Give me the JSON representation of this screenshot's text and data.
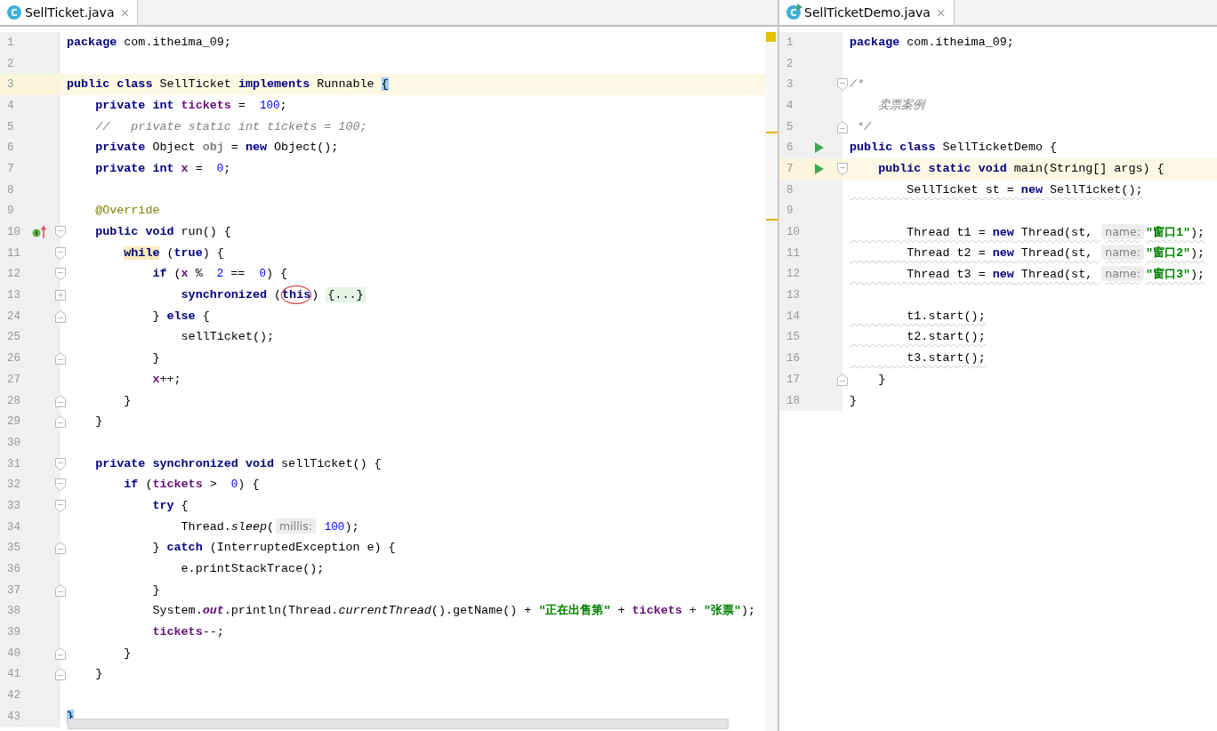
{
  "editors": [
    {
      "tab": {
        "icon_letter": "C",
        "kind": "class",
        "label": "SellTicket.java",
        "close": "×",
        "selected": true
      },
      "stripe_marks": [
        {
          "kind": "status"
        },
        {
          "kind": "warning"
        },
        {
          "kind": "warning"
        }
      ],
      "horizontal_scrollbar": true,
      "lines": [
        {
          "n": "1",
          "code": [
            {
              "kind": "kw",
              "text": "package"
            },
            {
              "kind": "plain",
              "text": " com.itheima_09;"
            }
          ]
        },
        {
          "n": "2"
        },
        {
          "n": "3",
          "current": true,
          "code": [
            {
              "kind": "kw",
              "text": "public class"
            },
            {
              "kind": "plain",
              "text": " SellTicket "
            },
            {
              "kind": "kw",
              "text": "implements"
            },
            {
              "kind": "plain",
              "text": " Runnable "
            },
            {
              "kind": "brace",
              "text": "{"
            }
          ]
        },
        {
          "n": "4",
          "code": [
            {
              "kind": "kw",
              "text": "    private int "
            },
            {
              "kind": "field",
              "text": "tickets"
            },
            {
              "kind": "plain",
              "text": " = "
            },
            {
              "kind": "num",
              "text": "100"
            },
            {
              "kind": "plain",
              "text": ";"
            }
          ]
        },
        {
          "n": "5",
          "code": [
            {
              "kind": "comment",
              "text": "    //   private static int tickets = 100;"
            }
          ]
        },
        {
          "n": "6",
          "code": [
            {
              "kind": "kw",
              "text": "    private"
            },
            {
              "kind": "plain",
              "text": " Object "
            },
            {
              "kind": "unused",
              "text": "obj"
            },
            {
              "kind": "plain",
              "text": " = "
            },
            {
              "kind": "kw",
              "text": "new"
            },
            {
              "kind": "plain",
              "text": " Object();"
            }
          ]
        },
        {
          "n": "7",
          "code": [
            {
              "kind": "kw",
              "text": "    private int "
            },
            {
              "kind": "field",
              "text": "x"
            },
            {
              "kind": "plain",
              "text": " = "
            },
            {
              "kind": "num",
              "text": "0"
            },
            {
              "kind": "plain",
              "text": ";"
            }
          ]
        },
        {
          "n": "8"
        },
        {
          "n": "9",
          "code": [
            {
              "kind": "annot",
              "text": "    @Override"
            }
          ]
        },
        {
          "n": "10",
          "kind": "implements",
          "fold_start": true,
          "code": [
            {
              "kind": "kw",
              "text": "    public void"
            },
            {
              "kind": "plain",
              "text": " run() {"
            }
          ]
        },
        {
          "n": "11",
          "fold_start": true,
          "code": [
            {
              "kind": "match",
              "text": "        while"
            },
            {
              "kind": "plain",
              "text": " ("
            },
            {
              "kind": "kw",
              "text": "true"
            },
            {
              "kind": "plain",
              "text": ") {"
            }
          ]
        },
        {
          "n": "12",
          "fold_start": true,
          "code": [
            {
              "kind": "kw",
              "text": "            if"
            },
            {
              "kind": "plain",
              "text": " ("
            },
            {
              "kind": "field",
              "text": "x"
            },
            {
              "kind": "plain",
              "text": " % "
            },
            {
              "kind": "num",
              "text": "2"
            },
            {
              "kind": "plain",
              "text": " == "
            },
            {
              "kind": "num",
              "text": "0"
            },
            {
              "kind": "plain",
              "text": ") {"
            }
          ]
        },
        {
          "n": "13",
          "collapsed": true,
          "code": [
            {
              "kind": "kw",
              "text": "                synchronized"
            },
            {
              "kind": "plain",
              "text": " ("
            },
            {
              "kind": "circled",
              "text": "this"
            },
            {
              "kind": "plain",
              "text": ") "
            },
            {
              "kind": "folded",
              "text": "{...}"
            }
          ]
        },
        {
          "n": "24",
          "fold_end": true,
          "code": [
            {
              "kind": "plain",
              "text": "            } "
            },
            {
              "kind": "kw",
              "text": "else"
            },
            {
              "kind": "plain",
              "text": " {"
            }
          ]
        },
        {
          "n": "25",
          "code": [
            {
              "kind": "plain",
              "text": "                sellTicket();"
            }
          ]
        },
        {
          "n": "26",
          "fold_end": true,
          "code": [
            {
              "kind": "plain",
              "text": "            }"
            }
          ]
        },
        {
          "n": "27",
          "code": [
            {
              "kind": "field",
              "text": "            x"
            },
            {
              "kind": "plain",
              "text": "++;"
            }
          ]
        },
        {
          "n": "28",
          "fold_end": true,
          "code": [
            {
              "kind": "plain",
              "text": "        }"
            }
          ]
        },
        {
          "n": "29",
          "fold_end": true,
          "code": [
            {
              "kind": "plain",
              "text": "    }"
            }
          ]
        },
        {
          "n": "30"
        },
        {
          "n": "31",
          "fold_start": true,
          "code": [
            {
              "kind": "kw",
              "text": "    private synchronized void"
            },
            {
              "kind": "plain",
              "text": " sellTicket() {"
            }
          ]
        },
        {
          "n": "32",
          "fold_start": true,
          "code": [
            {
              "kind": "kw",
              "text": "        if"
            },
            {
              "kind": "plain",
              "text": " ("
            },
            {
              "kind": "field",
              "text": "tickets"
            },
            {
              "kind": "plain",
              "text": " > "
            },
            {
              "kind": "num",
              "text": "0"
            },
            {
              "kind": "plain",
              "text": ") {"
            }
          ]
        },
        {
          "n": "33",
          "fold_start": true,
          "code": [
            {
              "kind": "kw",
              "text": "            try"
            },
            {
              "kind": "plain",
              "text": " {"
            }
          ]
        },
        {
          "n": "34",
          "code": [
            {
              "kind": "plain",
              "text": "                Thread."
            },
            {
              "kind": "italic",
              "text": "sleep"
            },
            {
              "kind": "plain",
              "text": "("
            },
            {
              "kind": "hint",
              "text": "millis:"
            },
            {
              "kind": "num",
              "text": "100"
            },
            {
              "kind": "plain",
              "text": ");"
            }
          ]
        },
        {
          "n": "35",
          "fold_end": true,
          "code": [
            {
              "kind": "plain",
              "text": "            } "
            },
            {
              "kind": "kw",
              "text": "catch"
            },
            {
              "kind": "plain",
              "text": " (InterruptedException e) {"
            }
          ]
        },
        {
          "n": "36",
          "code": [
            {
              "kind": "plain",
              "text": "                e.printStackTrace();"
            }
          ]
        },
        {
          "n": "37",
          "fold_end": true,
          "code": [
            {
              "kind": "plain",
              "text": "            }"
            }
          ]
        },
        {
          "n": "38",
          "code": [
            {
              "kind": "plain",
              "text": "            System."
            },
            {
              "kind": "static",
              "text": "out"
            },
            {
              "kind": "plain",
              "text": ".println(Thread."
            },
            {
              "kind": "italic",
              "text": "currentThread"
            },
            {
              "kind": "plain",
              "text": "().getName() + "
            },
            {
              "kind": "str",
              "text": "\"正在出售第\""
            },
            {
              "kind": "plain",
              "text": " + "
            },
            {
              "kind": "field",
              "text": "tickets"
            },
            {
              "kind": "plain",
              "text": " + "
            },
            {
              "kind": "str",
              "text": "\"张票\""
            },
            {
              "kind": "plain",
              "text": ");"
            }
          ]
        },
        {
          "n": "39",
          "code": [
            {
              "kind": "field",
              "text": "            tickets"
            },
            {
              "kind": "plain",
              "text": "--;"
            }
          ]
        },
        {
          "n": "40",
          "fold_end": true,
          "code": [
            {
              "kind": "plain",
              "text": "        }"
            }
          ]
        },
        {
          "n": "41",
          "fold_end": true,
          "code": [
            {
              "kind": "plain",
              "text": "    }"
            }
          ]
        },
        {
          "n": "42"
        },
        {
          "n": "43",
          "code": [
            {
              "kind": "brace",
              "text": "}"
            }
          ]
        }
      ]
    },
    {
      "tab": {
        "icon_letter": "C",
        "kind": "runnable",
        "label": "SellTicketDemo.java",
        "close": "×",
        "selected": true
      },
      "lines": [
        {
          "n": "1",
          "code": [
            {
              "kind": "kw",
              "text": "package"
            },
            {
              "kind": "plain",
              "text": " com.itheima_09;"
            }
          ]
        },
        {
          "n": "2"
        },
        {
          "n": "3",
          "fold_start": true,
          "code": [
            {
              "kind": "comment",
              "text": "/*"
            }
          ]
        },
        {
          "n": "4",
          "code": [
            {
              "kind": "comment",
              "text": "    卖票案例"
            }
          ]
        },
        {
          "n": "5",
          "fold_end": true,
          "code": [
            {
              "kind": "comment",
              "text": " */"
            }
          ]
        },
        {
          "n": "6",
          "kind": "run",
          "code": [
            {
              "kind": "kw",
              "text": "public class"
            },
            {
              "kind": "plain",
              "text": " SellTicketDemo {"
            }
          ]
        },
        {
          "n": "7",
          "kind": "run",
          "fold_start": true,
          "current": true,
          "code": [
            {
              "kind": "kw",
              "text": "    public static void"
            },
            {
              "kind": "plain",
              "text": " main(String[] args) {"
            }
          ]
        },
        {
          "n": "8",
          "warning": true,
          "code": [
            {
              "kind": "plain",
              "text": "        SellTicket st = "
            },
            {
              "kind": "kw",
              "text": "new"
            },
            {
              "kind": "plain",
              "text": " SellTicket();"
            }
          ]
        },
        {
          "n": "9"
        },
        {
          "n": "10",
          "warning": true,
          "code": [
            {
              "kind": "plain",
              "text": "        Thread t1 = "
            },
            {
              "kind": "kw",
              "text": "new"
            },
            {
              "kind": "plain",
              "text": " Thread(st, "
            },
            {
              "kind": "hint",
              "text": "name:"
            },
            {
              "kind": "str",
              "text": "\"窗口1\""
            },
            {
              "kind": "plain",
              "text": ");"
            }
          ]
        },
        {
          "n": "11",
          "warning": true,
          "code": [
            {
              "kind": "plain",
              "text": "        Thread t2 = "
            },
            {
              "kind": "kw",
              "text": "new"
            },
            {
              "kind": "plain",
              "text": " Thread(st, "
            },
            {
              "kind": "hint",
              "text": "name:"
            },
            {
              "kind": "str",
              "text": "\"窗口2\""
            },
            {
              "kind": "plain",
              "text": ");"
            }
          ]
        },
        {
          "n": "12",
          "warning": true,
          "code": [
            {
              "kind": "plain",
              "text": "        Thread t3 = "
            },
            {
              "kind": "kw",
              "text": "new"
            },
            {
              "kind": "plain",
              "text": " Thread(st, "
            },
            {
              "kind": "hint",
              "text": "name:"
            },
            {
              "kind": "str",
              "text": "\"窗口3\""
            },
            {
              "kind": "plain",
              "text": ");"
            }
          ]
        },
        {
          "n": "13"
        },
        {
          "n": "14",
          "warning": true,
          "code": [
            {
              "kind": "plain",
              "text": "        t1.start();"
            }
          ]
        },
        {
          "n": "15",
          "warning": true,
          "code": [
            {
              "kind": "plain",
              "text": "        t2.start();"
            }
          ]
        },
        {
          "n": "16",
          "warning": true,
          "code": [
            {
              "kind": "plain",
              "text": "        t3.start();"
            }
          ]
        },
        {
          "n": "17",
          "fold_end": true,
          "code": [
            {
              "kind": "plain",
              "text": "    }"
            }
          ]
        },
        {
          "n": "18",
          "code": [
            {
              "kind": "plain",
              "text": "}"
            }
          ]
        }
      ]
    }
  ]
}
